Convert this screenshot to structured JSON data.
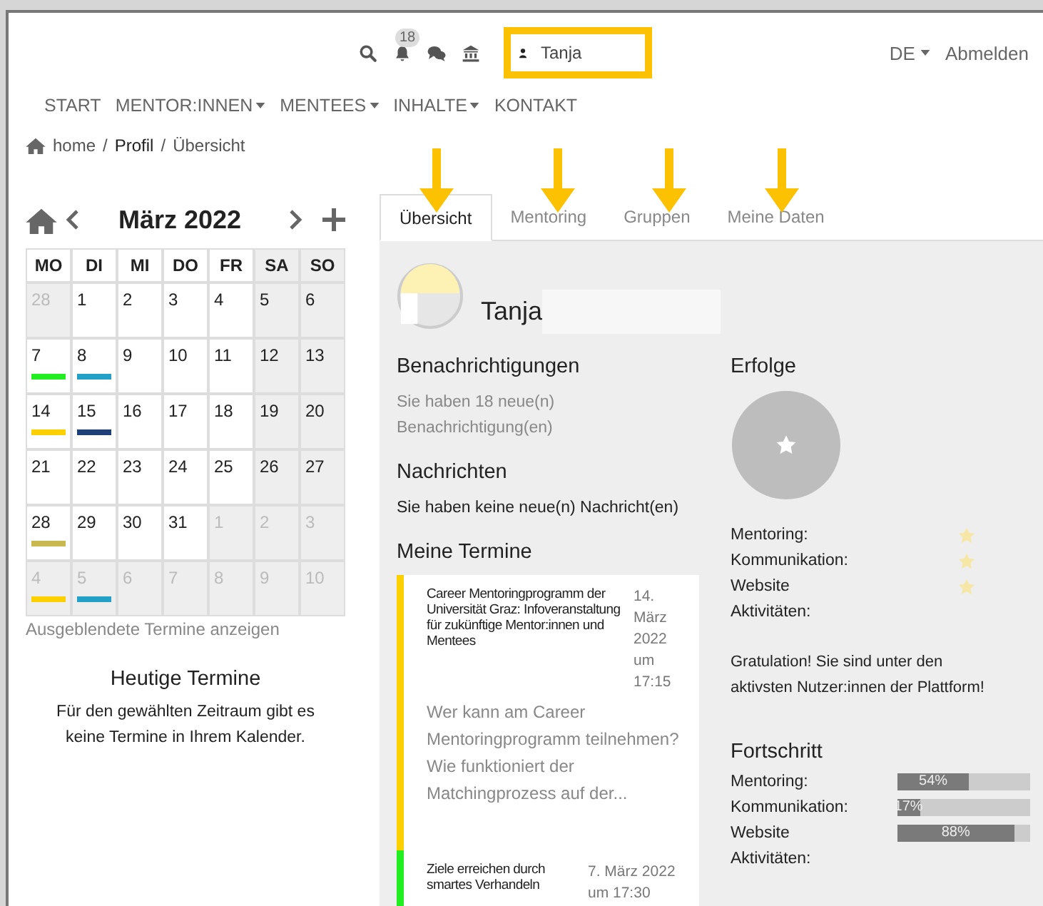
{
  "header": {
    "notification_count": "18",
    "user_field": "Tanja",
    "language": "DE",
    "logout": "Abmelden"
  },
  "nav": [
    {
      "label": "START",
      "dropdown": false
    },
    {
      "label": "MENTOR:INNEN",
      "dropdown": true
    },
    {
      "label": "MENTEES",
      "dropdown": true
    },
    {
      "label": "INHALTE",
      "dropdown": true
    },
    {
      "label": "KONTAKT",
      "dropdown": false
    }
  ],
  "breadcrumb": [
    {
      "kind": "link",
      "text": "home"
    },
    {
      "kind": "separator",
      "text": "/"
    },
    {
      "kind": "current",
      "text": "Profil"
    },
    {
      "kind": "separator",
      "text": "/"
    },
    {
      "kind": "link",
      "text": "Übersicht"
    }
  ],
  "calendar": {
    "title": "März 2022",
    "weekdays": [
      "MO",
      "DI",
      "MI",
      "DO",
      "FR",
      "SA",
      "SO"
    ],
    "weeks": [
      [
        {
          "day": "28",
          "muted": true
        },
        {
          "day": "1",
          "muted": false
        },
        {
          "day": "2",
          "muted": false
        },
        {
          "day": "3",
          "muted": false
        },
        {
          "day": "4",
          "muted": false
        },
        {
          "day": "5",
          "muted": false
        },
        {
          "day": "6",
          "muted": false
        }
      ],
      [
        {
          "day": "7",
          "muted": false,
          "color": "#22ee22"
        },
        {
          "day": "8",
          "muted": false,
          "color": "#22a0c8"
        },
        {
          "day": "9",
          "muted": false
        },
        {
          "day": "10",
          "muted": false
        },
        {
          "day": "11",
          "muted": false
        },
        {
          "day": "12",
          "muted": false
        },
        {
          "day": "13",
          "muted": false
        }
      ],
      [
        {
          "day": "14",
          "muted": false,
          "color": "#ffd000"
        },
        {
          "day": "15",
          "muted": false,
          "color": "#1f3f78"
        },
        {
          "day": "16",
          "muted": false
        },
        {
          "day": "17",
          "muted": false
        },
        {
          "day": "18",
          "muted": false
        },
        {
          "day": "19",
          "muted": false
        },
        {
          "day": "20",
          "muted": false
        }
      ],
      [
        {
          "day": "21",
          "muted": false
        },
        {
          "day": "22",
          "muted": false
        },
        {
          "day": "23",
          "muted": false
        },
        {
          "day": "24",
          "muted": false
        },
        {
          "day": "25",
          "muted": false
        },
        {
          "day": "26",
          "muted": false
        },
        {
          "day": "27",
          "muted": false
        }
      ],
      [
        {
          "day": "28",
          "muted": false,
          "color": "#c8b850"
        },
        {
          "day": "29",
          "muted": false
        },
        {
          "day": "30",
          "muted": false
        },
        {
          "day": "31",
          "muted": false
        },
        {
          "day": "1",
          "muted": true
        },
        {
          "day": "2",
          "muted": true
        },
        {
          "day": "3",
          "muted": true
        }
      ],
      [
        {
          "day": "4",
          "muted": true,
          "color": "#ffd000"
        },
        {
          "day": "5",
          "muted": true,
          "color": "#22a0c8"
        },
        {
          "day": "6",
          "muted": true
        },
        {
          "day": "7",
          "muted": true
        },
        {
          "day": "8",
          "muted": true
        },
        {
          "day": "9",
          "muted": true
        },
        {
          "day": "10",
          "muted": true
        }
      ]
    ],
    "hidden_link": "Ausgeblendete Termine anzeigen"
  },
  "today": {
    "title": "Heutige Termine",
    "text": "Für den gewählten Zeitraum gibt es keine Termine in Ihrem Kalender."
  },
  "tabs": [
    {
      "label": "Übersicht",
      "selected": true
    },
    {
      "label": "Mentoring",
      "selected": false
    },
    {
      "label": "Gruppen",
      "selected": false
    },
    {
      "label": "Meine Daten",
      "selected": false
    }
  ],
  "profile": {
    "name": "Tanja"
  },
  "notifications": {
    "title": "Benachrichtigungen",
    "text": "Sie haben 18 neue(n) Benachrichtigung(en)"
  },
  "messages": {
    "title": "Nachrichten",
    "text": "Sie haben keine neue(n) Nachricht(en)"
  },
  "appointments": {
    "title": "Meine Termine",
    "items": [
      {
        "title": "Career Mentoringprogramm der Universität Graz: Infoveranstaltung für zukünftige Mentor:innen und Mentees",
        "date": "14. März 2022 um 17:15",
        "teaser": "Wer kann am Career Mentoringprogramm teilnehmen? Wie funktioniert der Matchingprozess auf der...",
        "color": "#ffd000"
      },
      {
        "title": "Ziele erreichen durch smartes Verhandeln",
        "date": "7. März 2022 um 17:30",
        "color": "#22ee22"
      }
    ]
  },
  "achievements": {
    "title": "Erfolge",
    "rows": [
      {
        "label": "Mentoring:",
        "earned": true
      },
      {
        "label": "Kommunikation:",
        "earned": true
      },
      {
        "label": "Website",
        "earned": true
      },
      {
        "label": "Aktivitäten:",
        "earned": false
      }
    ],
    "message": "Gratulation! Sie sind unter den aktivsten Nutzer:innen der Plattform!"
  },
  "progress": {
    "title": "Fortschritt",
    "rows": [
      {
        "label": "Mentoring:",
        "level": 0.54,
        "reading": "54%"
      },
      {
        "label": "Kommunikation:",
        "level": 0.17,
        "reading": "17%"
      },
      {
        "label": "Website",
        "level": 0.88,
        "reading": "88%"
      },
      {
        "label": "Aktivitäten:"
      }
    ]
  }
}
